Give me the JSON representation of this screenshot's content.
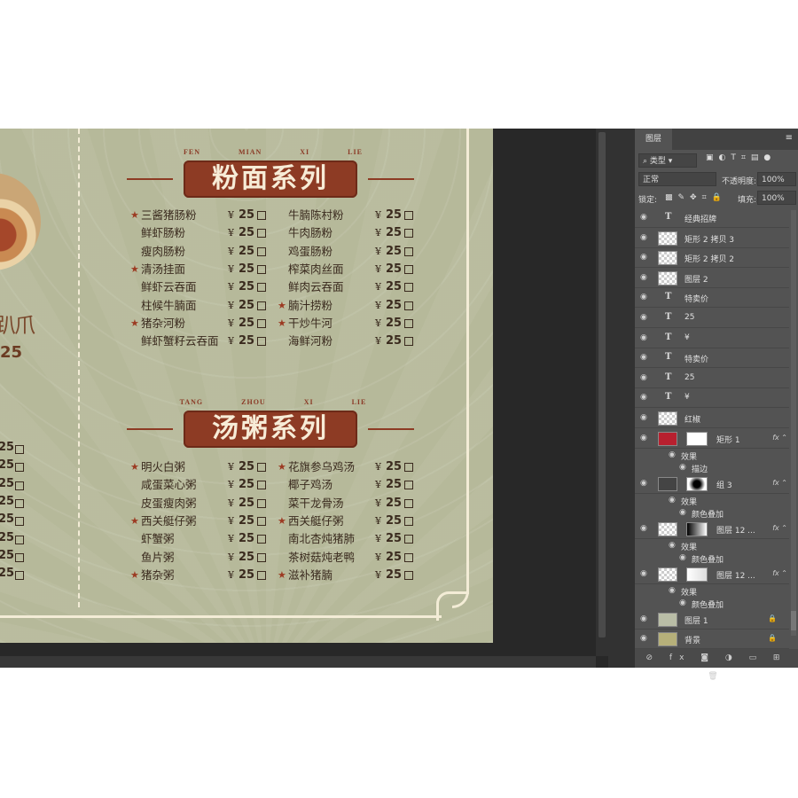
{
  "colors": {
    "canvas_bg": "#b6b99a",
    "brand_red": "#8d3b24",
    "cream": "#f3ecd6",
    "panel_bg": "#535353"
  },
  "canvas": {
    "badge_text": "趴爪",
    "badge_price": "25",
    "left_column": {
      "price": "25",
      "count": 8
    },
    "noodle_section": {
      "pinyin": "FEN MIAN XI LIE",
      "title": "粉面系列",
      "col1": [
        {
          "name": "三酱猪肠粉",
          "star": true,
          "yen": "¥",
          "price": "25"
        },
        {
          "name": "鲜虾肠粉",
          "star": false,
          "yen": "¥",
          "price": "25"
        },
        {
          "name": "瘦肉肠粉",
          "star": false,
          "yen": "¥",
          "price": "25"
        },
        {
          "name": "清汤挂面",
          "star": true,
          "yen": "¥",
          "price": "25"
        },
        {
          "name": "鲜虾云吞面",
          "star": false,
          "yen": "¥",
          "price": "25"
        },
        {
          "name": "柱候牛腩面",
          "star": false,
          "yen": "¥",
          "price": "25"
        },
        {
          "name": "猪杂河粉",
          "star": true,
          "yen": "¥",
          "price": "25"
        },
        {
          "name": "鲜虾蟹籽云吞面",
          "star": false,
          "yen": "¥",
          "price": "25"
        }
      ],
      "col2": [
        {
          "name": "牛腩陈村粉",
          "star": false,
          "yen": "¥",
          "price": "25"
        },
        {
          "name": "牛肉肠粉",
          "star": false,
          "yen": "¥",
          "price": "25"
        },
        {
          "name": "鸡蛋肠粉",
          "star": false,
          "yen": "¥",
          "price": "25"
        },
        {
          "name": "榨菜肉丝面",
          "star": false,
          "yen": "¥",
          "price": "25"
        },
        {
          "name": "鲜肉云吞面",
          "star": false,
          "yen": "¥",
          "price": "25"
        },
        {
          "name": "腩汁捞粉",
          "star": true,
          "yen": "¥",
          "price": "25"
        },
        {
          "name": "干炒牛河",
          "star": true,
          "yen": "¥",
          "price": "25"
        },
        {
          "name": "海鲜河粉",
          "star": false,
          "yen": "¥",
          "price": "25"
        }
      ]
    },
    "porridge_section": {
      "pinyin": "TANG ZHOU XI LIE",
      "title": "汤粥系列",
      "col1": [
        {
          "name": "明火白粥",
          "star": true,
          "yen": "¥",
          "price": "25"
        },
        {
          "name": "咸蛋菜心粥",
          "star": false,
          "yen": "¥",
          "price": "25"
        },
        {
          "name": "皮蛋瘦肉粥",
          "star": false,
          "yen": "¥",
          "price": "25"
        },
        {
          "name": "西关艇仔粥",
          "star": true,
          "yen": "¥",
          "price": "25"
        },
        {
          "name": "虾蟹粥",
          "star": false,
          "yen": "¥",
          "price": "25"
        },
        {
          "name": "鱼片粥",
          "star": false,
          "yen": "¥",
          "price": "25"
        },
        {
          "name": "猪杂粥",
          "star": true,
          "yen": "¥",
          "price": "25"
        }
      ],
      "col2": [
        {
          "name": "花旗参乌鸡汤",
          "star": true,
          "yen": "¥",
          "price": "25"
        },
        {
          "name": "椰子鸡汤",
          "star": false,
          "yen": "¥",
          "price": "25"
        },
        {
          "name": "菜干龙骨汤",
          "star": false,
          "yen": "¥",
          "price": "25"
        },
        {
          "name": "西关艇仔粥",
          "star": true,
          "yen": "¥",
          "price": "25"
        },
        {
          "name": "南北杏炖猪肺",
          "star": false,
          "yen": "¥",
          "price": "25"
        },
        {
          "name": "茶树菇炖老鸭",
          "star": false,
          "yen": "¥",
          "price": "25"
        },
        {
          "name": "滋补猪腩",
          "star": true,
          "yen": "¥",
          "price": "25"
        }
      ]
    }
  },
  "panel": {
    "tab": "图层",
    "filter_kind": "类型",
    "blend_mode": "正常",
    "opacity_label": "不透明度:",
    "opacity_value": "100%",
    "lock_label": "锁定:",
    "fill_label": "填充:",
    "fill_value": "100%",
    "layers": [
      {
        "name": "经典招牌",
        "kind": "text"
      },
      {
        "name": "矩形 2 拷贝 3",
        "kind": "image"
      },
      {
        "name": "矩形 2 拷贝 2",
        "kind": "image"
      },
      {
        "name": "图层 2",
        "kind": "image"
      },
      {
        "name": "特卖价",
        "kind": "text"
      },
      {
        "name": "25",
        "kind": "text"
      },
      {
        "name": "¥",
        "kind": "text"
      },
      {
        "name": "特卖价",
        "kind": "text"
      },
      {
        "name": "25",
        "kind": "text"
      },
      {
        "name": "¥",
        "kind": "text"
      },
      {
        "name": "红椒",
        "kind": "image"
      }
    ],
    "rect_layer": {
      "name": "矩形 1",
      "effects_label": "效果",
      "effect": "描边"
    },
    "group_layer": {
      "name": "组 3",
      "effects_label": "效果",
      "effect": "颜色叠加"
    },
    "layer_12a": {
      "name": "图层 12 ...",
      "effects_label": "效果",
      "effect": "颜色叠加"
    },
    "layer_12b": {
      "name": "图层 12 ...",
      "effects_label": "效果",
      "effect": "颜色叠加"
    },
    "layer_1": {
      "name": "图层 1"
    },
    "background": {
      "name": "背景"
    }
  }
}
